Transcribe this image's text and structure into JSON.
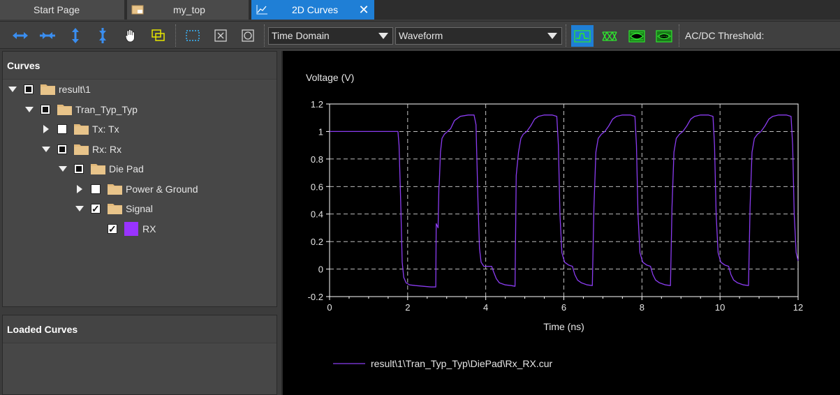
{
  "tabs": {
    "start_page": "Start Page",
    "my_top": "my_top",
    "curves_2d": "2D Curves",
    "close_icon": "close-icon"
  },
  "toolbar": {
    "icons": [
      "pan-left-right-icon",
      "zoom-horizontal-icon",
      "pan-up-down-icon",
      "zoom-vertical-icon",
      "hand-pan-icon",
      "zoom-window-icon",
      "select-rectangle-icon",
      "fit-all-icon",
      "zoom-extents-icon"
    ],
    "domain_select": "Time Domain",
    "view_select": "Waveform",
    "mode_icons": [
      "waveform-mode-icon",
      "eye-diagram-icon",
      "eye-mask-icon",
      "eye-density-icon"
    ],
    "threshold_label": "AC/DC Threshold:",
    "accent_color": "#1f7fd6",
    "mode_icon_color": "#2ee62e"
  },
  "curves_panel": {
    "title": "Curves",
    "tree": [
      {
        "label": "result\\1",
        "state": "partial",
        "expand": "down"
      },
      {
        "label": "Tran_Typ_Typ",
        "state": "partial",
        "expand": "down"
      },
      {
        "label": "Tx: Tx",
        "state": "unchecked",
        "expand": "right"
      },
      {
        "label": "Rx: Rx",
        "state": "partial",
        "expand": "down"
      },
      {
        "label": "Die Pad",
        "state": "partial",
        "expand": "down"
      },
      {
        "label": "Power & Ground",
        "state": "unchecked",
        "expand": "right"
      },
      {
        "label": "Signal",
        "state": "checked",
        "expand": "down"
      },
      {
        "label": "RX",
        "state": "checked",
        "expand": "none",
        "color": "#9933ff"
      }
    ]
  },
  "loaded_panel": {
    "title": "Loaded Curves"
  },
  "chart_data": {
    "type": "line",
    "title": "",
    "xlabel": "Time (ns)",
    "ylabel": "Voltage (V)",
    "xlim": [
      0,
      12
    ],
    "ylim": [
      -0.2,
      1.2
    ],
    "xticks": [
      "0",
      "2",
      "4",
      "6",
      "8",
      "10",
      "12"
    ],
    "yticks": [
      "1.2",
      "1",
      "0.8",
      "0.6",
      "0.4",
      "0.2",
      "0",
      "-0.2"
    ],
    "grid": true,
    "legend_position": "bottom-left",
    "series": [
      {
        "name": "result\\1\\Tran_Typ_Typ\\DiePad\\Rx_RX.cur",
        "color": "#8a3cf0",
        "x": [
          0,
          1.75,
          1.78,
          1.82,
          1.86,
          1.9,
          1.96,
          2.05,
          2.2,
          2.4,
          2.6,
          2.72,
          2.73,
          2.78,
          2.8,
          2.81,
          2.82,
          2.84,
          2.88,
          2.94,
          3.02,
          3.1,
          3.2,
          3.35,
          3.55,
          3.7,
          3.75,
          3.8,
          3.84,
          3.88,
          3.95,
          4.05,
          4.15,
          4.2,
          4.27,
          4.35,
          4.5,
          4.65,
          4.75,
          4.78,
          4.84,
          4.9,
          4.96,
          5.05,
          5.15,
          5.25,
          5.35,
          5.5,
          5.7,
          5.82,
          5.86,
          5.9,
          5.95,
          6.02,
          6.12,
          6.22,
          6.28,
          6.35,
          6.45,
          6.6,
          6.73,
          6.77,
          6.82,
          6.88,
          6.96,
          7.05,
          7.15,
          7.25,
          7.35,
          7.5,
          7.7,
          7.82,
          7.86,
          7.9,
          7.95,
          8.02,
          8.12,
          8.22,
          8.28,
          8.35,
          8.45,
          8.6,
          8.73,
          8.77,
          8.82,
          8.88,
          8.96,
          9.05,
          9.15,
          9.25,
          9.35,
          9.5,
          9.7,
          9.82,
          9.86,
          9.9,
          9.95,
          10.02,
          10.12,
          10.22,
          10.28,
          10.35,
          10.45,
          10.6,
          10.73,
          10.77,
          10.82,
          10.88,
          10.96,
          11.05,
          11.15,
          11.25,
          11.35,
          11.5,
          11.7,
          11.82,
          11.86,
          11.9,
          11.95,
          12.0
        ],
        "values": [
          1.0,
          1.0,
          0.9,
          0.5,
          0.05,
          -0.06,
          -0.1,
          -0.115,
          -0.12,
          -0.125,
          -0.13,
          -0.13,
          0.33,
          0.3,
          0.6,
          0.62,
          0.7,
          0.85,
          0.95,
          0.98,
          1.0,
          1.02,
          1.08,
          1.11,
          1.12,
          1.12,
          1.05,
          0.5,
          0.15,
          0.05,
          0.02,
          0.02,
          0.02,
          -0.02,
          -0.07,
          -0.1,
          -0.115,
          -0.12,
          -0.125,
          0.68,
          0.85,
          0.95,
          0.98,
          1.0,
          1.04,
          1.09,
          1.11,
          1.12,
          1.12,
          1.11,
          0.9,
          0.4,
          0.12,
          0.05,
          0.03,
          0.02,
          -0.04,
          -0.08,
          -0.1,
          -0.115,
          -0.12,
          0.45,
          0.85,
          0.95,
          0.98,
          1.0,
          1.04,
          1.09,
          1.11,
          1.12,
          1.12,
          1.11,
          0.9,
          0.4,
          0.12,
          0.05,
          0.03,
          0.02,
          -0.04,
          -0.08,
          -0.1,
          -0.115,
          -0.12,
          0.45,
          0.85,
          0.95,
          0.98,
          1.0,
          1.04,
          1.09,
          1.11,
          1.12,
          1.12,
          1.11,
          0.9,
          0.4,
          0.12,
          0.05,
          0.03,
          0.02,
          -0.04,
          -0.08,
          -0.1,
          -0.115,
          -0.12,
          0.45,
          0.85,
          0.95,
          0.98,
          1.0,
          1.04,
          1.09,
          1.11,
          1.12,
          1.12,
          1.11,
          0.9,
          0.4,
          0.12,
          0.06
        ]
      }
    ]
  }
}
